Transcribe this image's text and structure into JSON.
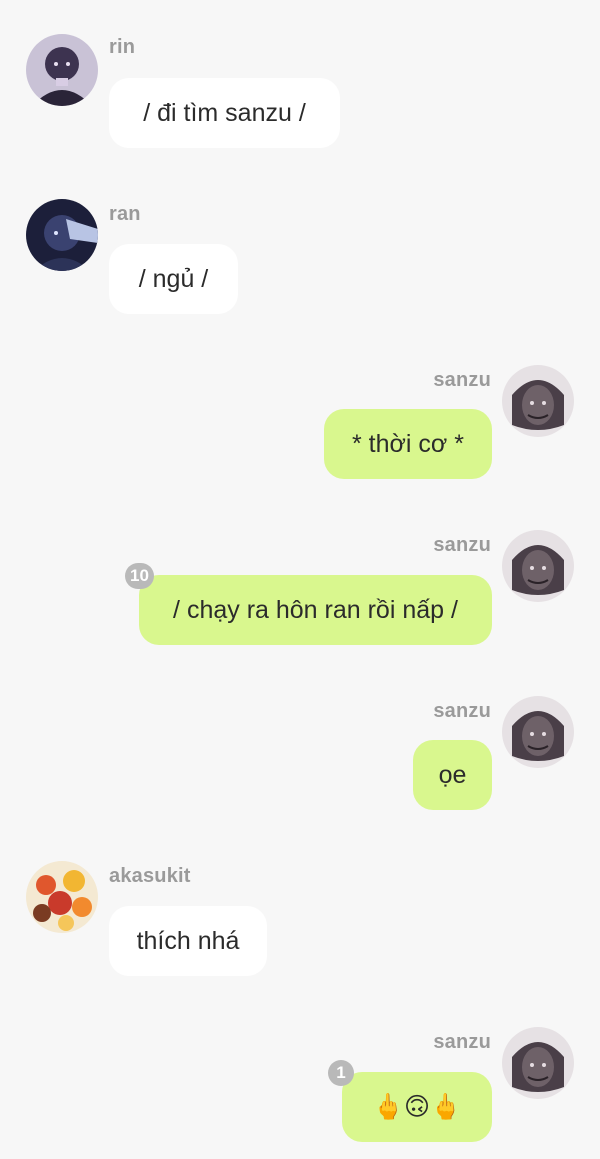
{
  "messages": [
    {
      "sender": "rin",
      "text": "/ đi tìm sanzu /",
      "direction": "incoming"
    },
    {
      "sender": "ran",
      "text": "/ ngủ /",
      "direction": "incoming"
    },
    {
      "sender": "sanzu",
      "text": "* thời cơ *",
      "direction": "outgoing"
    },
    {
      "sender": "sanzu",
      "text": "/ chạy ra hôn ran rồi nấp /",
      "direction": "outgoing",
      "reaction_count": "10"
    },
    {
      "sender": "sanzu",
      "text": "ọe",
      "direction": "outgoing"
    },
    {
      "sender": "akasukit",
      "text": "thích nhá",
      "direction": "incoming"
    },
    {
      "sender": "sanzu",
      "text": "🖕🙃🖕",
      "direction": "outgoing",
      "reaction_count": "1"
    }
  ],
  "colors": {
    "background": "#f7f7f7",
    "incoming_bubble": "#ffffff",
    "outgoing_bubble": "#d9f78e",
    "name_text": "#9a9a9a",
    "badge": "#b9b9b9"
  },
  "icons": {
    "middle_finger": "middle-finger-emoji",
    "upside_down_face": "upside-down-face-emoji"
  }
}
